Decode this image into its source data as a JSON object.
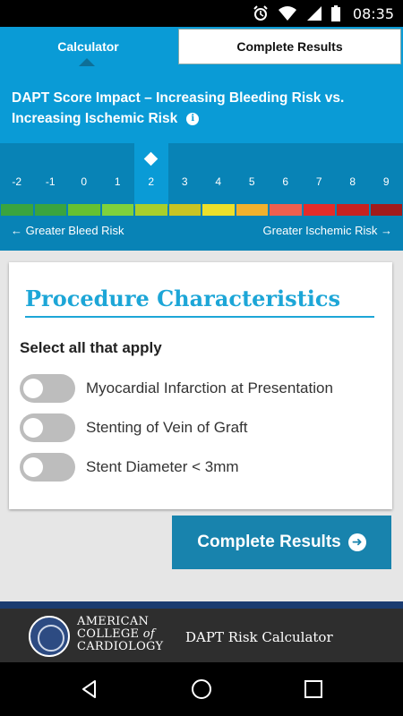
{
  "status_bar": {
    "time": "08:35"
  },
  "tabs": [
    {
      "label": "Calculator",
      "active": true
    },
    {
      "label": "Complete Results",
      "active": false
    }
  ],
  "dapt": {
    "title": "DAPT Score Impact – Increasing Bleeding Risk vs. Increasing Ischemic Risk",
    "scores": [
      "-2",
      "-1",
      "0",
      "1",
      "2",
      "3",
      "4",
      "5",
      "6",
      "7",
      "8",
      "9"
    ],
    "selected_score": "2",
    "bar_colors": [
      "#3aa43f",
      "#3aa43f",
      "#66c132",
      "#7fd23c",
      "#a7cf2c",
      "#c8c423",
      "#ece02b",
      "#f1b12e",
      "#ee5f4f",
      "#e32c2a",
      "#c62221",
      "#a11b1c"
    ],
    "left_label": "Greater Bleed Risk",
    "right_label": "Greater Ischemic Risk"
  },
  "procedure": {
    "title": "Procedure Characteristics",
    "instruction": "Select all that apply",
    "options": [
      {
        "label": "Myocardial Infarction at Presentation",
        "checked": false
      },
      {
        "label": "Stenting of Vein of Graft",
        "checked": false
      },
      {
        "label": "Stent Diameter < 3mm",
        "checked": false
      }
    ]
  },
  "actions": {
    "complete_results": "Complete Results"
  },
  "footer": {
    "org_line1": "AMERICAN",
    "org_line2a": "COLLEGE ",
    "org_line2b": "of",
    "org_line3": "CARDIOLOGY",
    "app_name": "DAPT Risk Calculator"
  },
  "colors": {
    "primary": "#0a9bd6",
    "dark_primary": "#0883b6",
    "button": "#1883ad",
    "footer": "#2e2e2e"
  }
}
